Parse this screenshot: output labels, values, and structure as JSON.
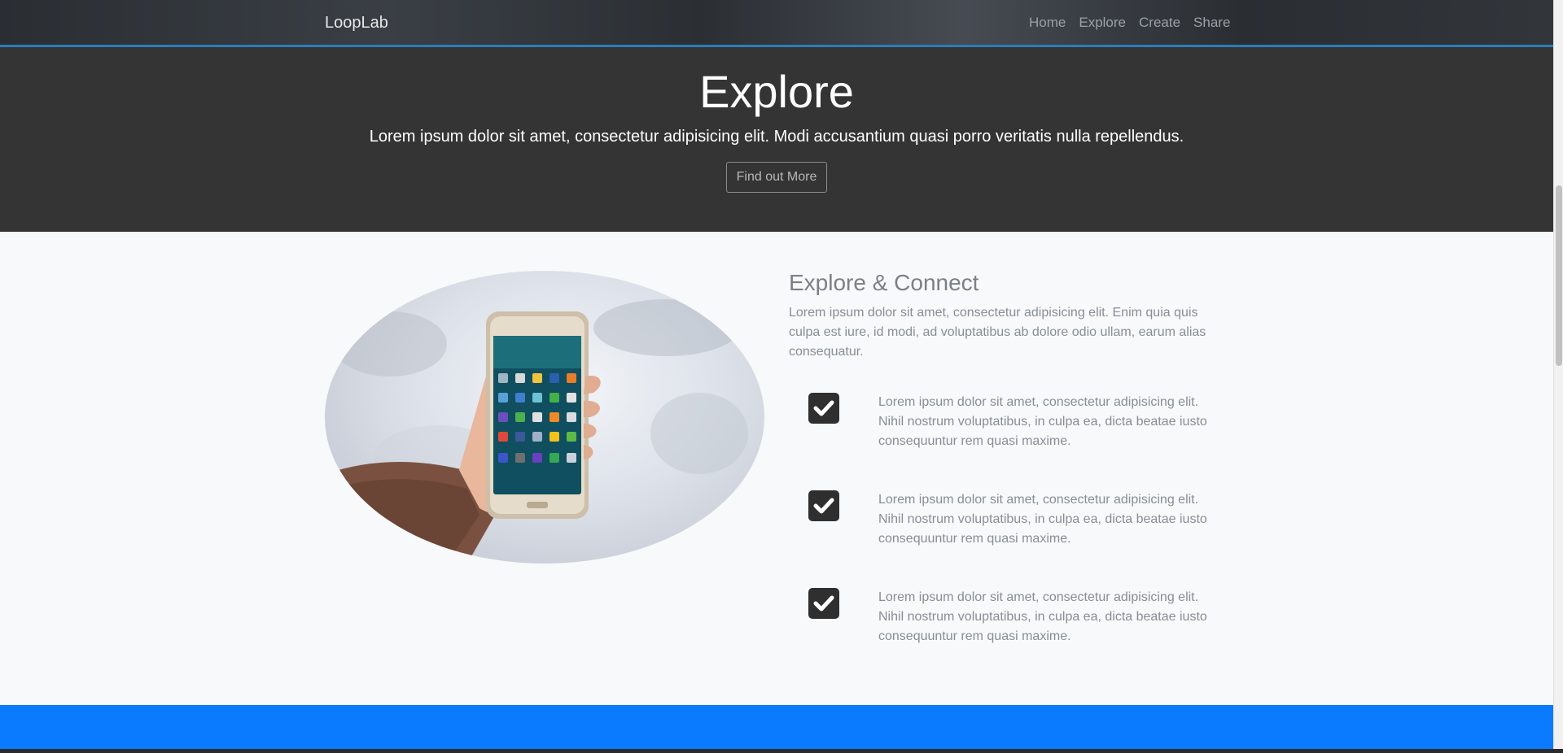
{
  "navbar": {
    "brand": "LoopLab",
    "links": [
      "Home",
      "Explore",
      "Create",
      "Share"
    ]
  },
  "hero": {
    "title": "Explore",
    "subtitle": "Lorem ipsum dolor sit amet, consectetur adipisicing elit. Modi accusantium quasi porro veritatis nulla repellendus.",
    "button_label": "Find out More"
  },
  "feature": {
    "image_icon": "phone-in-hand-photo",
    "title": "Explore & Connect",
    "text": "Lorem ipsum dolor sit amet, consectetur adipisicing elit. Enim quia quis culpa est iure, id modi, ad voluptatibus ab dolore odio ullam, earum alias consequatur.",
    "items": [
      {
        "icon": "check-square-icon",
        "text": "Lorem ipsum dolor sit amet, consectetur adipisicing elit. Nihil nostrum voluptatibus, in culpa ea, dicta beatae iusto consequuntur rem quasi maxime."
      },
      {
        "icon": "check-square-icon",
        "text": "Lorem ipsum dolor sit amet, consectetur adipisicing elit. Nihil nostrum voluptatibus, in culpa ea, dicta beatae iusto consequuntur rem quasi maxime."
      },
      {
        "icon": "check-square-icon",
        "text": "Lorem ipsum dolor sit amet, consectetur adipisicing elit. Nihil nostrum voluptatibus, in culpa ea, dicta beatae iusto consequuntur rem quasi maxime."
      }
    ]
  },
  "colors": {
    "hero_bg": "#343434",
    "accent_blue": "#0a7bff",
    "nav_border": "#2a7db8",
    "check_bg": "#2f2f2f"
  }
}
